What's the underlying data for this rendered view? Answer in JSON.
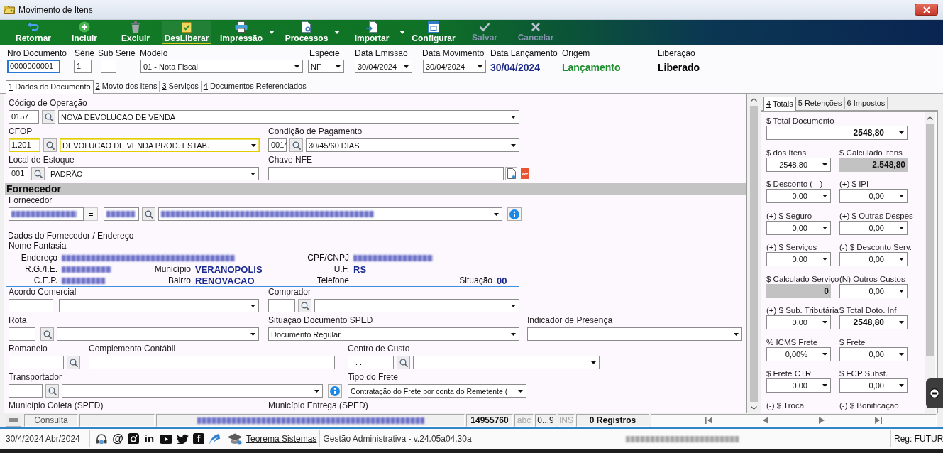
{
  "window": {
    "title": "Movimento de Itens"
  },
  "toolbar": [
    {
      "label": "Retornar",
      "kind": "return",
      "dropdown": false,
      "highlighted": false,
      "disabled": false
    },
    {
      "label": "Incluir",
      "kind": "add",
      "dropdown": false,
      "highlighted": false,
      "disabled": false
    },
    {
      "label": "Excluir",
      "kind": "delete",
      "dropdown": false,
      "highlighted": false,
      "disabled": false
    },
    {
      "label": "DesLiberar",
      "kind": "unrelease",
      "dropdown": false,
      "highlighted": true,
      "disabled": false
    },
    {
      "label": "Impressão",
      "kind": "print",
      "dropdown": true,
      "highlighted": false,
      "disabled": false
    },
    {
      "label": "Processos",
      "kind": "process",
      "dropdown": true,
      "highlighted": false,
      "disabled": false
    },
    {
      "label": "Importar",
      "kind": "import",
      "dropdown": true,
      "highlighted": false,
      "disabled": false
    },
    {
      "label": "Configurar",
      "kind": "configure",
      "dropdown": false,
      "highlighted": false,
      "disabled": false
    },
    {
      "label": "Salvar",
      "kind": "save",
      "dropdown": false,
      "highlighted": false,
      "disabled": true
    },
    {
      "label": "Cancelar",
      "kind": "cancel",
      "dropdown": false,
      "highlighted": false,
      "disabled": true
    }
  ],
  "header": {
    "fields": [
      {
        "label": "Nro Documento",
        "kind": "input",
        "value": "0000000001",
        "focused": true
      },
      {
        "label": "Série",
        "kind": "input",
        "value": "1",
        "focused": false
      },
      {
        "label": "Sub Série",
        "kind": "input",
        "focused": false
      },
      {
        "label": "Modelo",
        "kind": "combo",
        "value": "01 - Nota Fiscal",
        "focused": false
      },
      {
        "label": "Espécie",
        "kind": "combo",
        "value": "NF",
        "focused": false
      },
      {
        "label": "Data Emissão",
        "kind": "combo",
        "value": "30/04/2024",
        "focused": false
      },
      {
        "label": "Data Movimento",
        "kind": "combo",
        "value": "30/04/2024",
        "focused": false
      },
      {
        "label": "Data Lançamento",
        "kind": "display",
        "value": "30/04/2024",
        "color": "#1c2a85"
      },
      {
        "label": "Origem",
        "kind": "display",
        "value": "Lançamento",
        "color": "#1d8f2e"
      },
      {
        "label": "Liberação",
        "kind": "display",
        "value": "Liberado",
        "color": "#000000"
      }
    ]
  },
  "document_tabs": [
    {
      "key": "1",
      "label": "Dados do Documento",
      "selected": true
    },
    {
      "key": "2",
      "label": "Movto dos Itens",
      "selected": false
    },
    {
      "key": "3",
      "label": "Serviços",
      "selected": false
    },
    {
      "key": "4",
      "label": "Documentos Referenciados",
      "selected": false
    }
  ],
  "form_top": [
    {
      "fields": [
        {
          "label": "Código de Operação",
          "kind": "lookup",
          "code": "0157",
          "value": "NOVA DEVOLUCAO DE VENDA",
          "highlighted": false
        }
      ]
    },
    {
      "fields": [
        {
          "label": "CFOP",
          "kind": "lookup",
          "code": "1.201",
          "value": "DEVOLUCAO DE VENDA PROD. ESTAB.",
          "highlighted": true
        },
        {
          "label": "Condição de Pagamento",
          "kind": "lookup",
          "code": "0014",
          "value": "30/45/60 DIAS",
          "highlighted": false
        }
      ]
    },
    {
      "fields": [
        {
          "label": "Local de Estoque",
          "kind": "lookup",
          "code": "001",
          "value": "PADRÃO",
          "highlighted": false
        },
        {
          "label": "Chave NFE",
          "kind": "file_input",
          "highlighted": false
        }
      ]
    }
  ],
  "supplier": {
    "section_title": "Fornecedor",
    "label": "Fornecedor",
    "separator": "="
  },
  "address": {
    "title": "Dados do Fornecedor / Endereço",
    "name_label": "Nome Fantasia",
    "rows": [
      {
        "items": [
          {
            "label": "Endereço",
            "kind": "redacted"
          },
          {
            "label": "CPF/CNPJ",
            "kind": "redacted"
          }
        ]
      },
      {
        "items": [
          {
            "label": "R.G./I.E.",
            "kind": "redacted"
          },
          {
            "label": "Município",
            "kind": "text",
            "value": "VERANOPOLIS"
          },
          {
            "label": "U.F.",
            "kind": "text",
            "value": "RS"
          }
        ]
      },
      {
        "items": [
          {
            "label": "C.E.P.",
            "kind": "redacted"
          },
          {
            "label": "Bairro",
            "kind": "text",
            "value": "RENOVACAO"
          },
          {
            "label": "Telefone",
            "kind": "text"
          },
          {
            "label": "Situação",
            "kind": "text",
            "value": "00"
          }
        ]
      }
    ]
  },
  "form_bottom": [
    {
      "fields": [
        {
          "label": "Acordo Comercial",
          "kind": "input_combo",
          "highlighted": false
        },
        {
          "label": "Comprador",
          "kind": "lookup",
          "highlighted": false
        }
      ]
    },
    {
      "fields": [
        {
          "label": "Rota",
          "kind": "lookup",
          "highlighted": false
        },
        {
          "label": "Situação Documento SPED",
          "kind": "combo",
          "value": "Documento Regular",
          "highlighted": false
        },
        {
          "label": "Indicador de Presença",
          "kind": "combo",
          "highlighted": false
        }
      ]
    },
    {
      "fields": [
        {
          "label": "Romaneio",
          "kind": "input_search",
          "highlighted": false
        },
        {
          "label": "Complemento Contábil",
          "kind": "input",
          "highlighted": false
        },
        {
          "label": "Centro de Custo",
          "kind": "lookup",
          "code": ". .",
          "highlighted": false
        }
      ]
    },
    {
      "fields": [
        {
          "label": "Transportador",
          "kind": "lookup_info",
          "highlighted": false
        },
        {
          "label": "Tipo do Frete",
          "kind": "combo",
          "value": "Contratação do Frete por conta do Remetente (",
          "highlighted": false
        }
      ]
    },
    {
      "fields": [
        {
          "label": "Município Coleta (SPED)",
          "kind": "label"
        },
        {
          "label": "Município Entrega (SPED)",
          "kind": "label"
        }
      ]
    }
  ],
  "totals": {
    "tabs": [
      {
        "key": "4",
        "label": "Totais",
        "selected": true
      },
      {
        "key": "5",
        "label": "Retenções",
        "selected": false
      },
      {
        "key": "6",
        "label": "Impostos",
        "selected": false
      }
    ],
    "total": {
      "label": "$ Total Documento",
      "value": "2548,80",
      "kind": "total"
    },
    "items": [
      {
        "label": "$ dos Itens",
        "value": "2548,80",
        "kind": "combo"
      },
      {
        "label": "$ Calculado Itens",
        "value": "2.548,80",
        "kind": "computed"
      },
      {
        "label": "$ Desconto ( - )",
        "value": "0,00",
        "kind": "combo"
      },
      {
        "label": "(+) $ IPI",
        "value": "0,00",
        "kind": "combo"
      },
      {
        "label": "(+) $ Seguro",
        "value": "0,00",
        "kind": "combo"
      },
      {
        "label": "(+) $ Outras Despes",
        "value": "0,00",
        "kind": "combo"
      },
      {
        "label": "(+) $ Serviços",
        "value": "0,00",
        "kind": "combo"
      },
      {
        "label": "(-) $ Desconto Serv.",
        "value": "0,00",
        "kind": "combo"
      },
      {
        "label": "$ Calculado Serviço",
        "value": "0",
        "kind": "computed"
      },
      {
        "label": "(N) Outros Custos",
        "value": "0,00",
        "kind": "combo"
      },
      {
        "label": "(+) $ Sub. Tributária",
        "value": "0,00",
        "kind": "combo"
      },
      {
        "label": "$ Total Doto. Inf",
        "value": "2548,80",
        "kind": "total"
      },
      {
        "label": "% ICMS Frete",
        "value": "0,00%",
        "kind": "combo"
      },
      {
        "label": "$ Frete",
        "value": "0,00",
        "kind": "combo"
      },
      {
        "label": "$ Frete CTR",
        "value": "0,00",
        "kind": "combo"
      },
      {
        "label": "$ FCP Subst.",
        "value": "0,00",
        "kind": "combo"
      },
      {
        "label": "(-) $ Troca",
        "kind": "label"
      },
      {
        "label": "(-) $ Bonificação",
        "kind": "label"
      }
    ]
  },
  "status_bar": {
    "mode": "Consulta",
    "record": "14955760",
    "indicators": [
      {
        "label": "abc",
        "active": false
      },
      {
        "label": "0...9",
        "active": true
      },
      {
        "label": "INS",
        "active": false
      }
    ],
    "count": "0 Registros"
  },
  "footer": {
    "date": "30/4/2024 Abr/2024",
    "links": [
      {
        "kind": "support"
      },
      {
        "kind": "at",
        "glyph": "@"
      },
      {
        "kind": "camera"
      },
      {
        "kind": "in",
        "glyph": "in"
      },
      {
        "kind": "play"
      },
      {
        "kind": "bird"
      },
      {
        "kind": "f",
        "glyph": "f"
      },
      {
        "kind": "swoosh"
      }
    ],
    "company": "Teorema Sistemas",
    "version": "Gestão Administrativa - v.24.05a04.30a",
    "registration": "Reg: FUTUR"
  }
}
